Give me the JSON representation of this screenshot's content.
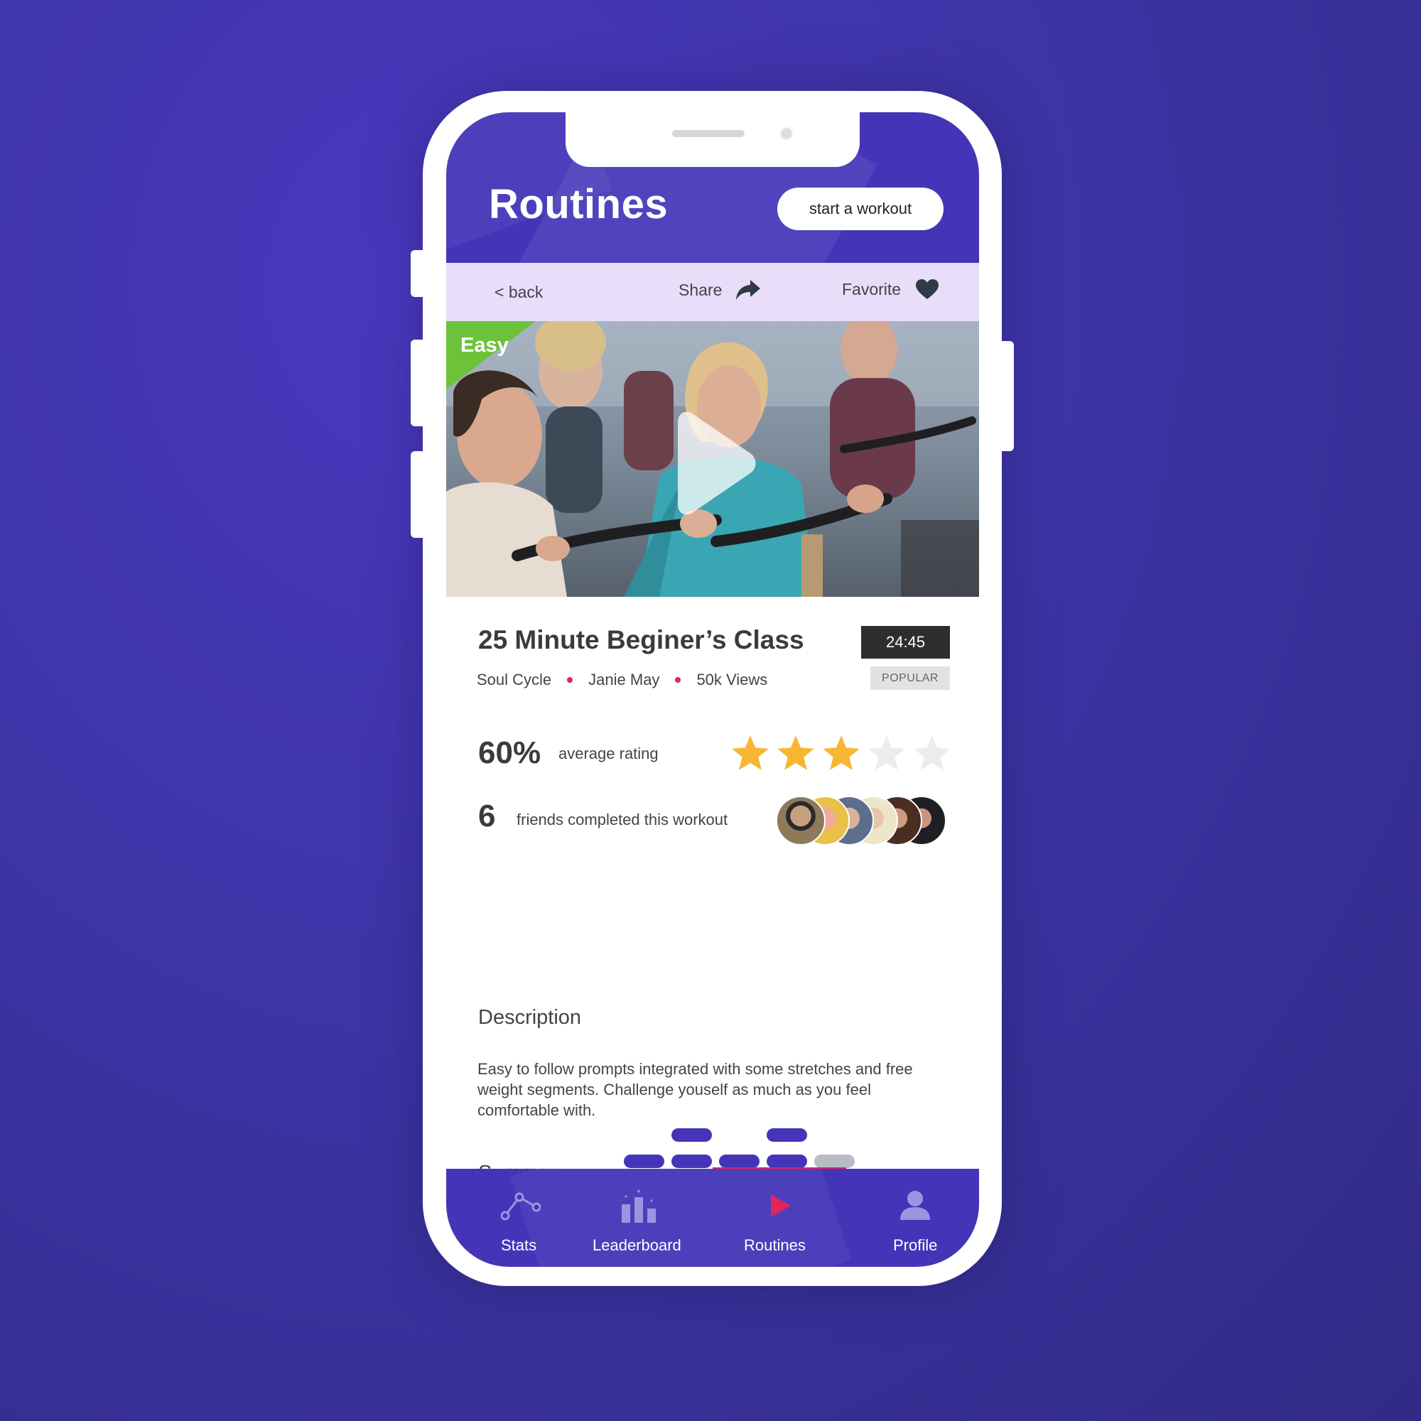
{
  "header": {
    "title": "Routines",
    "start_label": "start a workout"
  },
  "action_bar": {
    "back_label": "< back",
    "share_label": "Share",
    "favorite_label": "Favorite"
  },
  "hero": {
    "difficulty": "Easy"
  },
  "workout": {
    "title": "25 Minute Beginer’s Class",
    "duration": "24:45",
    "category": "Soul Cycle",
    "instructor": "Janie May",
    "views": "50k Views",
    "badge": "POPULAR"
  },
  "rating": {
    "value": "60%",
    "label": "average rating",
    "stars_filled": 3,
    "stars_total": 5
  },
  "friends": {
    "count": "6",
    "label": "friends completed this workout"
  },
  "description": {
    "title": "Description",
    "text": "Easy to follow prompts integrated with some stretches and free weight segments. Challenge youself as much as you feel comfortable with."
  },
  "summary": {
    "title": "Summary",
    "segment_levels": [
      1,
      2,
      1,
      2,
      1
    ],
    "segment_active": [
      true,
      true,
      true,
      true,
      false
    ]
  },
  "tabs": [
    {
      "label": "Stats",
      "icon": "stats-icon",
      "active": false
    },
    {
      "label": "Leaderboard",
      "icon": "leaderboard-icon",
      "active": false
    },
    {
      "label": "Routines",
      "icon": "play-icon",
      "active": true
    },
    {
      "label": "Profile",
      "icon": "profile-icon",
      "active": false
    }
  ],
  "colors": {
    "brand": "#4435b8",
    "accent": "#e0245e",
    "star": "#f7b733",
    "easy": "#6cc33a",
    "action_bar": "#e8defa"
  }
}
